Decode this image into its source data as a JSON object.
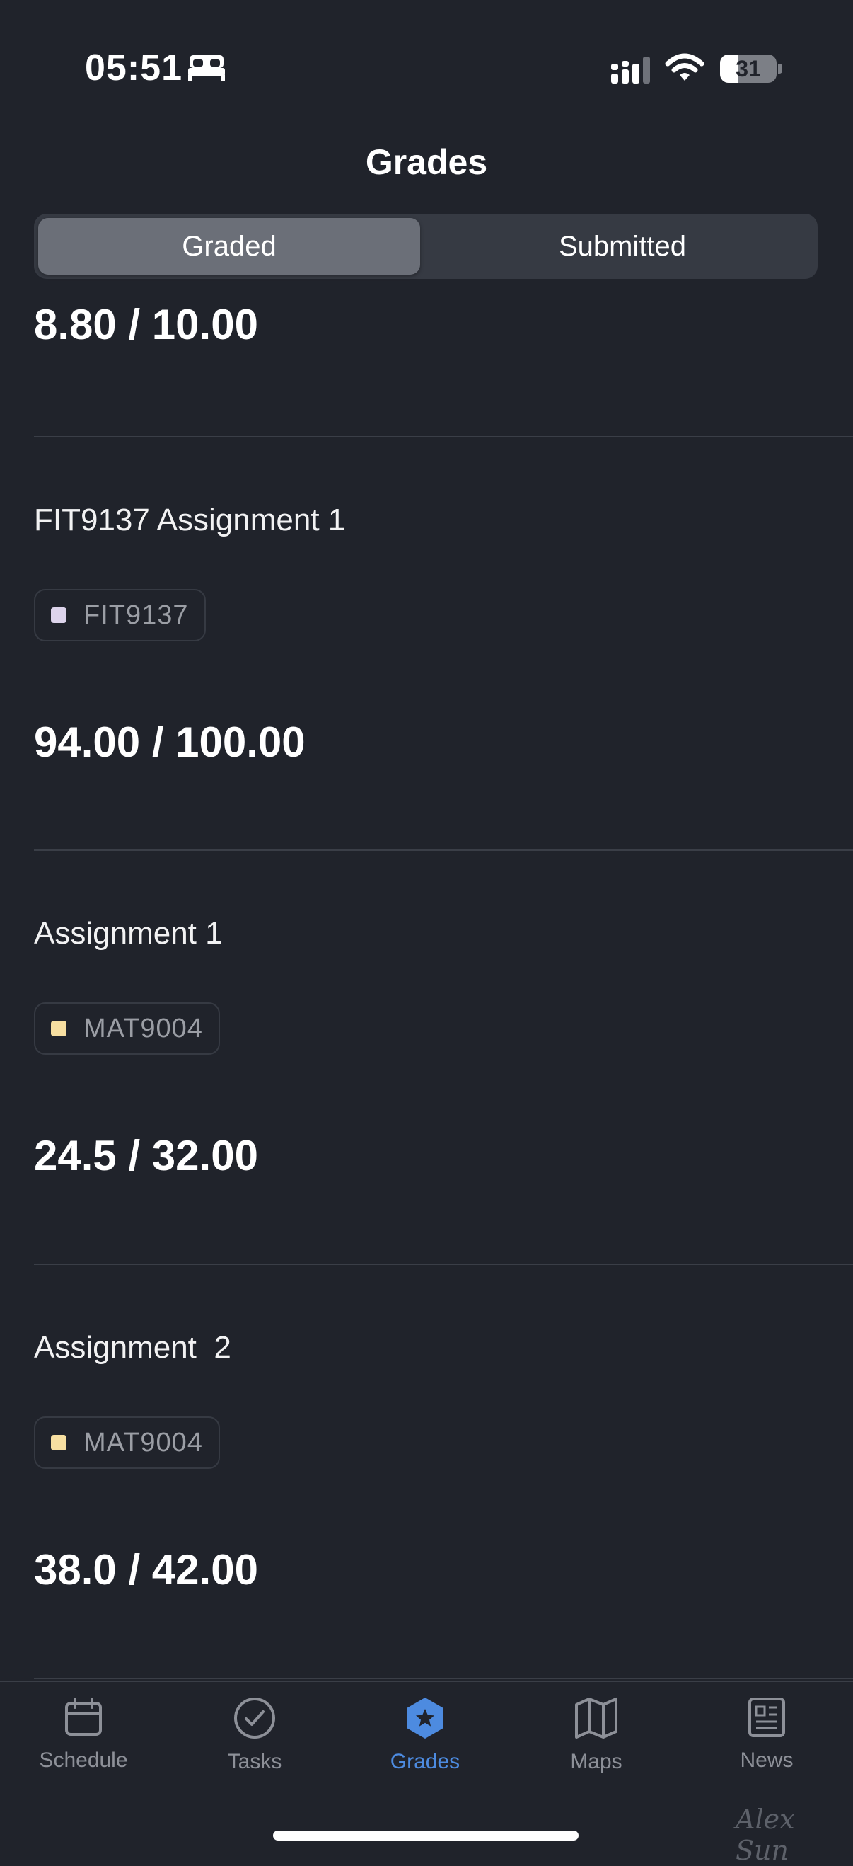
{
  "status_bar": {
    "time": "05:51",
    "battery_level": "31",
    "battery_fraction": 0.31
  },
  "header": {
    "title": "Grades"
  },
  "segments": {
    "graded": "Graded",
    "submitted": "Submitted"
  },
  "list": {
    "first_score": "8.80 / 10.00",
    "items": [
      {
        "title": "FIT9137 Assignment 1",
        "unit": "FIT9137",
        "unit_color": "#ddd4ec",
        "score": "94.00 / 100.00"
      },
      {
        "title": "Assignment 1",
        "unit": "MAT9004",
        "unit_color": "#f7dfa1",
        "score": "24.5 / 32.00"
      },
      {
        "title": "Assignment  2",
        "unit": "MAT9004",
        "unit_color": "#f7dfa1",
        "score": "38.0 / 42.00"
      }
    ]
  },
  "tab_bar": {
    "tabs": [
      {
        "label": "Schedule",
        "icon": "calendar-icon"
      },
      {
        "label": "Tasks",
        "icon": "checkmark-circle-icon"
      },
      {
        "label": "Grades",
        "icon": "star-hexagon-icon"
      },
      {
        "label": "Maps",
        "icon": "map-icon"
      },
      {
        "label": "News",
        "icon": "newspaper-icon"
      }
    ],
    "active": "Grades",
    "active_color": "#4d8be0",
    "inactive_color": "#8d9098"
  },
  "watermark": {
    "signature": "Alex Sun"
  }
}
